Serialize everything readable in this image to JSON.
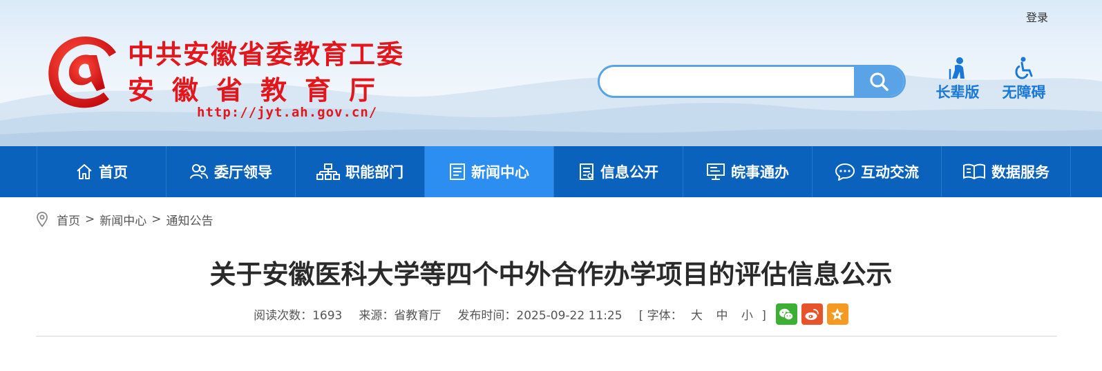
{
  "header": {
    "login_label": "登录",
    "logo": {
      "title_line1": "中共安徽省委教育工委",
      "title_line2": "安徽省教育厅",
      "url": "http://jyt.ah.gov.cn/"
    },
    "search": {
      "value": "",
      "placeholder": ""
    },
    "tools": {
      "elder_label": "长辈版",
      "accessible_label": "无障碍"
    }
  },
  "nav": {
    "items": [
      {
        "label": "首页",
        "icon": "home-icon"
      },
      {
        "label": "委厅领导",
        "icon": "leaders-icon"
      },
      {
        "label": "职能部门",
        "icon": "org-chart-icon"
      },
      {
        "label": "新闻中心",
        "icon": "news-icon",
        "active": true
      },
      {
        "label": "信息公开",
        "icon": "document-icon"
      },
      {
        "label": "皖事通办",
        "icon": "monitor-icon"
      },
      {
        "label": "互动交流",
        "icon": "chat-icon"
      },
      {
        "label": "数据服务",
        "icon": "book-icon"
      }
    ]
  },
  "breadcrumb": {
    "items": [
      "首页",
      "新闻中心",
      "通知公告"
    ],
    "separator": ">"
  },
  "article": {
    "title": "关于安徽医科大学等四个中外合作办学项目的评估信息公示",
    "meta": {
      "views_label": "阅读次数：",
      "views": "1693",
      "source_label": "来源：",
      "source": "省教育厅",
      "published_label": "发布时间：",
      "published": "2025-09-22 11:25",
      "font_open": "[ 字体：",
      "font_large": "大",
      "font_medium": "中",
      "font_small": "小",
      "font_close": "]"
    },
    "share": [
      "wechat-icon",
      "weibo-icon",
      "favorite-icon"
    ]
  },
  "colors": {
    "brand_red": "#e3161c",
    "nav_bg": "#0a62bd",
    "nav_active": "#2c8ef0",
    "accent_blue": "#1a79d6"
  }
}
